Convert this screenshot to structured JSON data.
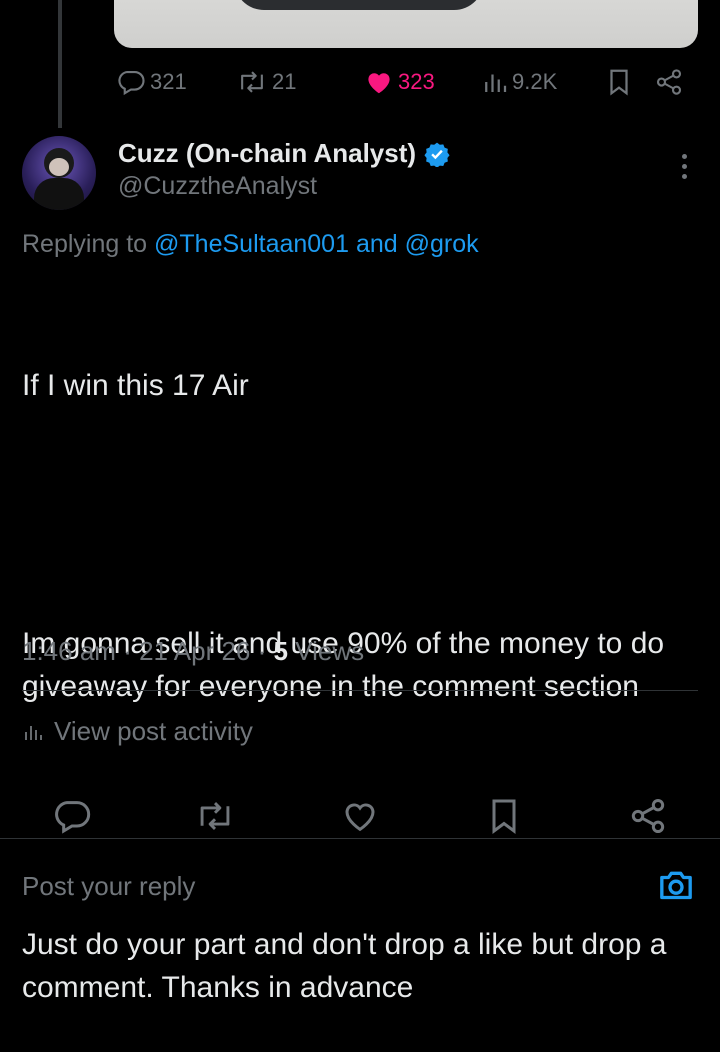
{
  "colors": {
    "background": "#000000",
    "text": "#e7e9ea",
    "muted": "#71767b",
    "link": "#1d9bf0",
    "like": "#f91880",
    "divider": "#2f3336"
  },
  "parent_actions": {
    "replies": "321",
    "reposts": "21",
    "likes": "323",
    "views": "9.2K"
  },
  "post": {
    "author_name": "Cuzz (On-chain Analyst)",
    "author_handle": "@CuzztheAnalyst",
    "verified_icon": "verified-badge-icon",
    "replying_prefix": "Replying to",
    "replying_mention_1": "@TheSultaan001",
    "replying_and": "and",
    "replying_mention_2": "@grok",
    "paragraph_1": "If I win this 17 Air",
    "paragraph_2": "Im gonna sell it and use 90% of the money to do giveaway for everyone in the comment section",
    "paragraph_3": "Just do your part and don't drop a like but drop a comment. Thanks in advance",
    "time": "1:46 am",
    "date": "21 Apr 26",
    "views_count": "5",
    "views_label": "Views"
  },
  "activity": {
    "label": "View post activity"
  },
  "reply": {
    "placeholder": "Post your reply"
  }
}
